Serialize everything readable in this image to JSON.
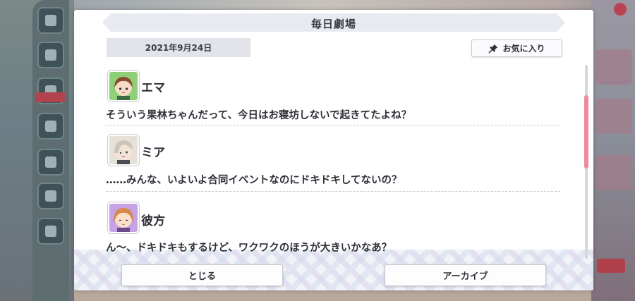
{
  "dialog": {
    "title": "毎日劇場",
    "date": "2021年9月24日",
    "favorite_label": "お気に入り",
    "favorite_icon": "pin-icon"
  },
  "messages": [
    {
      "name": "エマ",
      "text": "そういう果林ちゃんだって、今日はお寝坊しないで起きてたよね？",
      "avatar_bg": "#8fcf78",
      "hair": "#8a4a2c"
    },
    {
      "name": "ミア",
      "text": "……みんな、いよいよ合同イベントなのにドキドキしてないの？",
      "avatar_bg": "#e6e1d6",
      "hair": "#c9c6b8"
    },
    {
      "name": "彼方",
      "text": "ん〜、ドキドキもするけど、ワクワクのほうが大きいかなあ？",
      "avatar_bg": "#c7a3e6",
      "hair": "#d58a4a"
    }
  ],
  "buttons": {
    "close": "とじる",
    "archive": "アーカイブ"
  },
  "colors": {
    "scroll_thumb": "#ef8a9a",
    "title_bar": "#e8eaf1"
  }
}
